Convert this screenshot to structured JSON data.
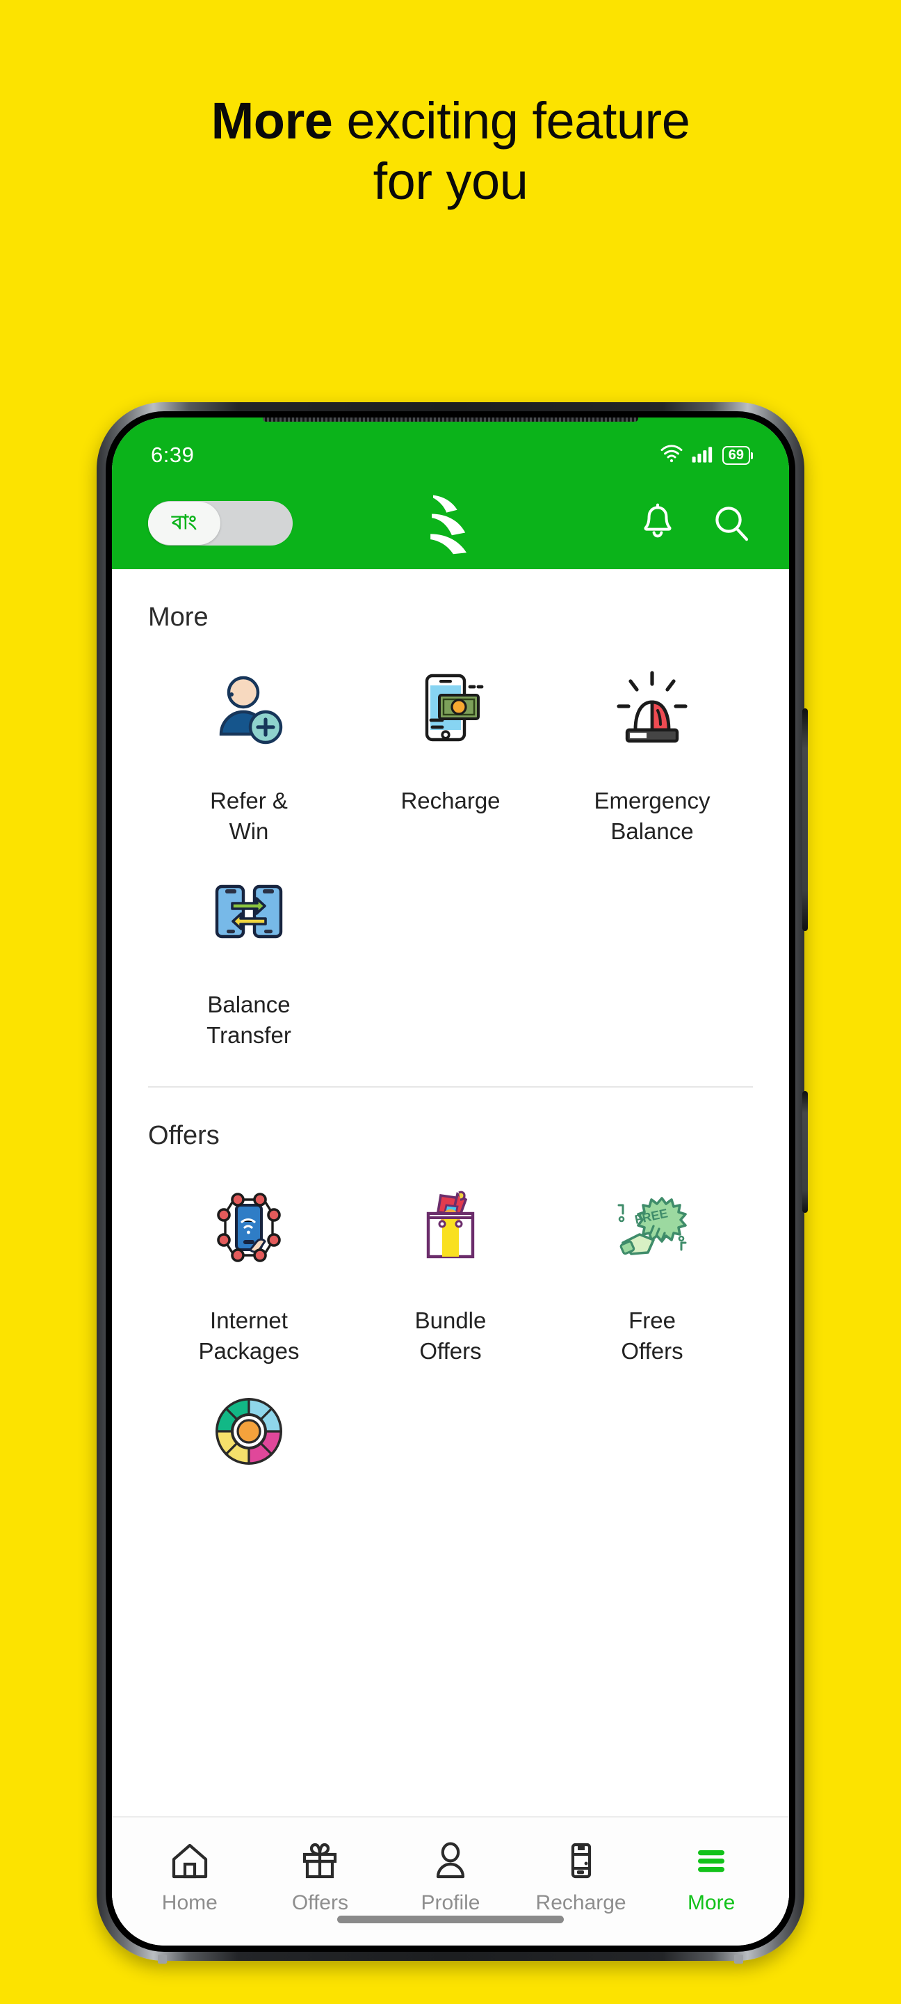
{
  "promo": {
    "headline_strong": "More",
    "headline_rest": " exciting feature",
    "headline_line2": "for you",
    "background_color": "#FCE300"
  },
  "phone": {
    "statusbar": {
      "time": "6:39",
      "wifi_icon": "wifi-icon",
      "signal_icon": "signal-bars-icon",
      "battery_level": "69",
      "battery_icon": "battery-icon"
    },
    "appbar": {
      "language_toggle_label": "বাং",
      "brand_logo": "brand-logo-icon",
      "notification_icon": "bell-icon",
      "search_icon": "search-icon",
      "background_color": "#0bb31a"
    }
  },
  "sections": [
    {
      "title": "More",
      "tiles": [
        {
          "label": "Refer &\nWin",
          "icon": "user-add-icon"
        },
        {
          "label": "Recharge",
          "icon": "phone-money-icon"
        },
        {
          "label": "Emergency\nBalance",
          "icon": "siren-icon"
        },
        {
          "label": "Balance\nTransfer",
          "icon": "phone-transfer-icon"
        }
      ]
    },
    {
      "title": "Offers",
      "tiles": [
        {
          "label": "Internet\nPackages",
          "icon": "network-phone-icon"
        },
        {
          "label": "Bundle\nOffers",
          "icon": "shopping-bag-icon"
        },
        {
          "label": "Free\nOffers",
          "icon": "free-megaphone-icon"
        },
        {
          "label": "",
          "icon": "color-wheel-icon"
        }
      ]
    }
  ],
  "bottom_nav": {
    "active": "More",
    "items": [
      {
        "label": "Home",
        "icon": "home-icon"
      },
      {
        "label": "Offers",
        "icon": "gift-icon"
      },
      {
        "label": "Profile",
        "icon": "person-icon"
      },
      {
        "label": "Recharge",
        "icon": "recharge-card-icon"
      },
      {
        "label": "More",
        "icon": "hamburger-icon"
      }
    ],
    "active_color": "#12c21a",
    "inactive_color": "#8e8e8e"
  }
}
